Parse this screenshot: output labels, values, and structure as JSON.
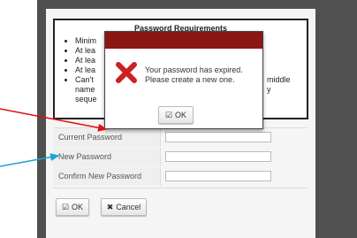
{
  "requirements": {
    "title": "Password Requirements",
    "items": [
      "Minim",
      "At lea",
      "At lea",
      "At lea",
      "Can't"
    ],
    "overflow_right": [
      "middle",
      "y"
    ],
    "overflow_left": [
      "name",
      "seque"
    ]
  },
  "form": {
    "rows": [
      {
        "label": "Current Password",
        "value": ""
      },
      {
        "label": "New Password",
        "value": ""
      },
      {
        "label": "Confirm New Password",
        "value": ""
      }
    ],
    "ok_label": "OK",
    "cancel_label": "Cancel"
  },
  "modal": {
    "message": "Your password has expired. Please create a new one.",
    "ok_label": "OK"
  },
  "colors": {
    "modal_header": "#8b1616",
    "error_icon": "#cc2222",
    "arrow_red": "#dd1111",
    "arrow_blue": "#1ea3d6"
  },
  "icons": [
    "check-square-icon",
    "x-mark-icon",
    "error-x-icon",
    "red-arrow",
    "blue-arrow"
  ]
}
